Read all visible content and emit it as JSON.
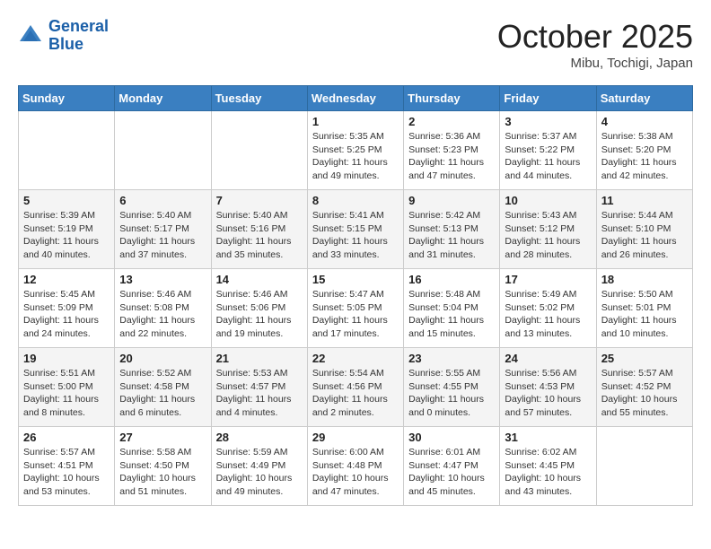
{
  "header": {
    "logo_line1": "General",
    "logo_line2": "Blue",
    "month": "October 2025",
    "location": "Mibu, Tochigi, Japan"
  },
  "weekdays": [
    "Sunday",
    "Monday",
    "Tuesday",
    "Wednesday",
    "Thursday",
    "Friday",
    "Saturday"
  ],
  "weeks": [
    [
      {
        "day": "",
        "info": ""
      },
      {
        "day": "",
        "info": ""
      },
      {
        "day": "",
        "info": ""
      },
      {
        "day": "1",
        "info": "Sunrise: 5:35 AM\nSunset: 5:25 PM\nDaylight: 11 hours\nand 49 minutes."
      },
      {
        "day": "2",
        "info": "Sunrise: 5:36 AM\nSunset: 5:23 PM\nDaylight: 11 hours\nand 47 minutes."
      },
      {
        "day": "3",
        "info": "Sunrise: 5:37 AM\nSunset: 5:22 PM\nDaylight: 11 hours\nand 44 minutes."
      },
      {
        "day": "4",
        "info": "Sunrise: 5:38 AM\nSunset: 5:20 PM\nDaylight: 11 hours\nand 42 minutes."
      }
    ],
    [
      {
        "day": "5",
        "info": "Sunrise: 5:39 AM\nSunset: 5:19 PM\nDaylight: 11 hours\nand 40 minutes."
      },
      {
        "day": "6",
        "info": "Sunrise: 5:40 AM\nSunset: 5:17 PM\nDaylight: 11 hours\nand 37 minutes."
      },
      {
        "day": "7",
        "info": "Sunrise: 5:40 AM\nSunset: 5:16 PM\nDaylight: 11 hours\nand 35 minutes."
      },
      {
        "day": "8",
        "info": "Sunrise: 5:41 AM\nSunset: 5:15 PM\nDaylight: 11 hours\nand 33 minutes."
      },
      {
        "day": "9",
        "info": "Sunrise: 5:42 AM\nSunset: 5:13 PM\nDaylight: 11 hours\nand 31 minutes."
      },
      {
        "day": "10",
        "info": "Sunrise: 5:43 AM\nSunset: 5:12 PM\nDaylight: 11 hours\nand 28 minutes."
      },
      {
        "day": "11",
        "info": "Sunrise: 5:44 AM\nSunset: 5:10 PM\nDaylight: 11 hours\nand 26 minutes."
      }
    ],
    [
      {
        "day": "12",
        "info": "Sunrise: 5:45 AM\nSunset: 5:09 PM\nDaylight: 11 hours\nand 24 minutes."
      },
      {
        "day": "13",
        "info": "Sunrise: 5:46 AM\nSunset: 5:08 PM\nDaylight: 11 hours\nand 22 minutes."
      },
      {
        "day": "14",
        "info": "Sunrise: 5:46 AM\nSunset: 5:06 PM\nDaylight: 11 hours\nand 19 minutes."
      },
      {
        "day": "15",
        "info": "Sunrise: 5:47 AM\nSunset: 5:05 PM\nDaylight: 11 hours\nand 17 minutes."
      },
      {
        "day": "16",
        "info": "Sunrise: 5:48 AM\nSunset: 5:04 PM\nDaylight: 11 hours\nand 15 minutes."
      },
      {
        "day": "17",
        "info": "Sunrise: 5:49 AM\nSunset: 5:02 PM\nDaylight: 11 hours\nand 13 minutes."
      },
      {
        "day": "18",
        "info": "Sunrise: 5:50 AM\nSunset: 5:01 PM\nDaylight: 11 hours\nand 10 minutes."
      }
    ],
    [
      {
        "day": "19",
        "info": "Sunrise: 5:51 AM\nSunset: 5:00 PM\nDaylight: 11 hours\nand 8 minutes."
      },
      {
        "day": "20",
        "info": "Sunrise: 5:52 AM\nSunset: 4:58 PM\nDaylight: 11 hours\nand 6 minutes."
      },
      {
        "day": "21",
        "info": "Sunrise: 5:53 AM\nSunset: 4:57 PM\nDaylight: 11 hours\nand 4 minutes."
      },
      {
        "day": "22",
        "info": "Sunrise: 5:54 AM\nSunset: 4:56 PM\nDaylight: 11 hours\nand 2 minutes."
      },
      {
        "day": "23",
        "info": "Sunrise: 5:55 AM\nSunset: 4:55 PM\nDaylight: 11 hours\nand 0 minutes."
      },
      {
        "day": "24",
        "info": "Sunrise: 5:56 AM\nSunset: 4:53 PM\nDaylight: 10 hours\nand 57 minutes."
      },
      {
        "day": "25",
        "info": "Sunrise: 5:57 AM\nSunset: 4:52 PM\nDaylight: 10 hours\nand 55 minutes."
      }
    ],
    [
      {
        "day": "26",
        "info": "Sunrise: 5:57 AM\nSunset: 4:51 PM\nDaylight: 10 hours\nand 53 minutes."
      },
      {
        "day": "27",
        "info": "Sunrise: 5:58 AM\nSunset: 4:50 PM\nDaylight: 10 hours\nand 51 minutes."
      },
      {
        "day": "28",
        "info": "Sunrise: 5:59 AM\nSunset: 4:49 PM\nDaylight: 10 hours\nand 49 minutes."
      },
      {
        "day": "29",
        "info": "Sunrise: 6:00 AM\nSunset: 4:48 PM\nDaylight: 10 hours\nand 47 minutes."
      },
      {
        "day": "30",
        "info": "Sunrise: 6:01 AM\nSunset: 4:47 PM\nDaylight: 10 hours\nand 45 minutes."
      },
      {
        "day": "31",
        "info": "Sunrise: 6:02 AM\nSunset: 4:45 PM\nDaylight: 10 hours\nand 43 minutes."
      },
      {
        "day": "",
        "info": ""
      }
    ]
  ]
}
